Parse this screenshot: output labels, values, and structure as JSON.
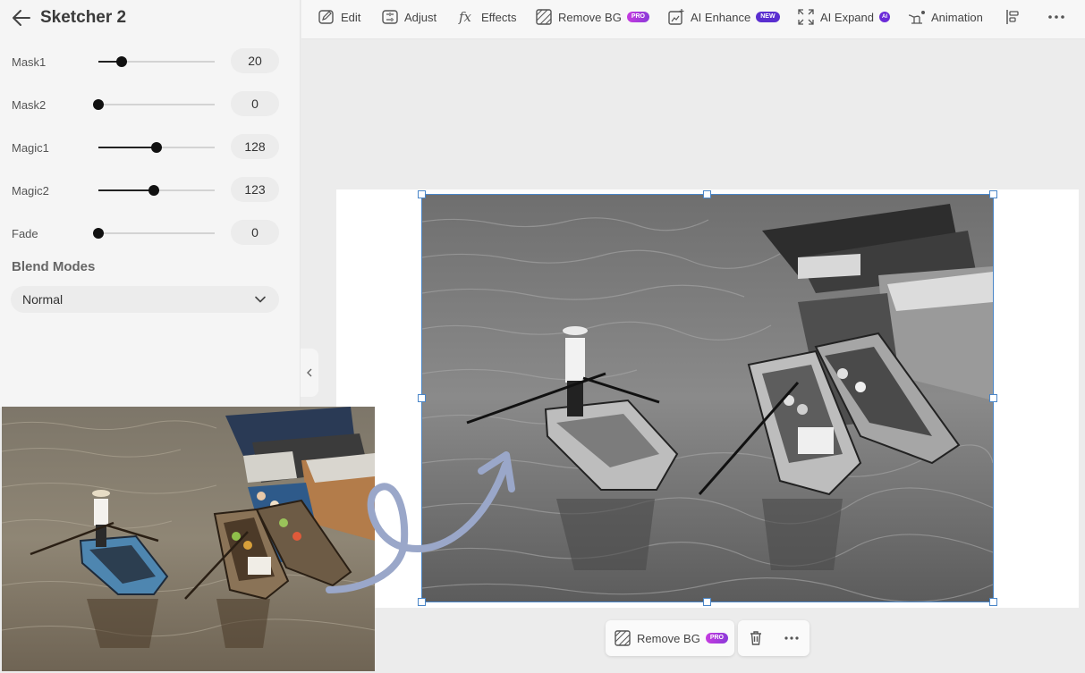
{
  "panel": {
    "title": "Sketcher 2",
    "sliders": [
      {
        "label": "Mask1",
        "value": "20",
        "fraction": 0.2
      },
      {
        "label": "Mask2",
        "value": "0",
        "fraction": 0.0
      },
      {
        "label": "Magic1",
        "value": "128",
        "fraction": 0.5
      },
      {
        "label": "Magic2",
        "value": "123",
        "fraction": 0.48
      },
      {
        "label": "Fade",
        "value": "0",
        "fraction": 0.0
      }
    ],
    "blend_title": "Blend Modes",
    "blend_value": "Normal"
  },
  "toolbar": {
    "edit": "Edit",
    "adjust": "Adjust",
    "effects": "Effects",
    "remove_bg": "Remove BG",
    "remove_bg_badge": "PRO",
    "ai_enhance": "AI Enhance",
    "ai_enhance_badge": "NEW",
    "ai_expand": "AI Expand",
    "ai_expand_badge": "AI",
    "animation": "Animation"
  },
  "action_bar": {
    "remove_bg": "Remove BG",
    "badge": "PRO"
  },
  "colors": {
    "selection": "#4a86c8",
    "pro_badge": "#b43ce0",
    "new_badge": "#5a2fd0",
    "arrow": "#9aa7c9"
  }
}
